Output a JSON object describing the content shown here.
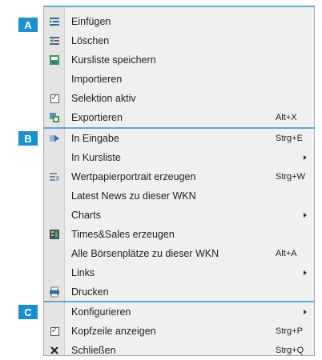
{
  "badges": {
    "a": "A",
    "b": "B",
    "c": "C"
  },
  "items": {
    "einfuegen": "Einfügen",
    "loeschen": "Löschen",
    "kursliste_speichern": "Kursliste speichern",
    "importieren": "Importieren",
    "selektion_aktiv": "Selektion aktiv",
    "exportieren": "Exportieren",
    "exportieren_shortcut": "Alt+X",
    "in_eingabe": "In Eingabe",
    "in_eingabe_shortcut": "Strg+E",
    "in_kursliste": "In Kursliste",
    "wertpapierportrait": "Wertpapierportrait erzeugen",
    "wertpapierportrait_shortcut": "Strg+W",
    "latest_news": "Latest News zu dieser WKN",
    "charts": "Charts",
    "times_sales": "Times&Sales erzeugen",
    "alle_boersenplaetze": "Alle Börsenplätze zu dieser WKN",
    "alle_boersenplaetze_shortcut": "Alt+A",
    "links": "Links",
    "drucken": "Drucken",
    "konfigurieren": "Konfigurieren",
    "kopfzeile_anzeigen": "Kopfzeile anzeigen",
    "kopfzeile_anzeigen_shortcut": "Strg+P",
    "schliessen": "Schließen",
    "schliessen_shortcut": "Strg+Q"
  },
  "state": {
    "selektion_aktiv_checked": true,
    "kopfzeile_anzeigen_checked": true
  },
  "icons": {
    "einfuegen": "insert-icon",
    "loeschen": "delete-icon",
    "kursliste_speichern": "save-list-icon",
    "exportieren": "export-icon",
    "in_eingabe": "input-icon",
    "wertpapierportrait": "portrait-icon",
    "times_sales": "times-sales-icon",
    "drucken": "printer-icon",
    "schliessen": "close-icon"
  },
  "colors": {
    "badge": "#1a8fd1",
    "separator": "#5ea9d7",
    "menu_bg": "#f0f0f0"
  }
}
